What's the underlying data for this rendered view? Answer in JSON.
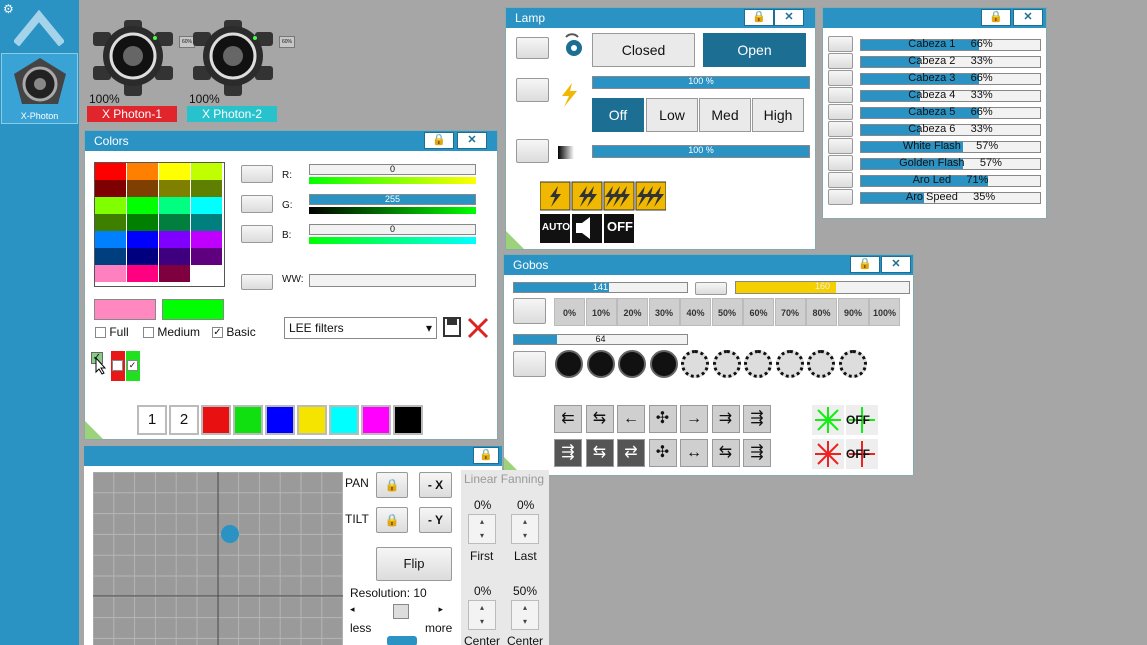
{
  "sidebar": {
    "fixture_label": "X-Photon",
    "icons": [
      "gear-icon",
      "chevron-up-icon"
    ]
  },
  "fixtures": [
    {
      "pct": "100%",
      "name": "X Photon-1",
      "color": "#e0252d",
      "badge": "60%"
    },
    {
      "pct": "100%",
      "name": "X Photon-2",
      "color": "#28c2cc",
      "badge": "60%"
    }
  ],
  "colors": {
    "title": "Colors",
    "palette": [
      "#ff0000",
      "#ff8000",
      "#ffff00",
      "#bfff00",
      "#7f0000",
      "#7f3f00",
      "#7f7f00",
      "#5f7f00",
      "#80ff00",
      "#00ff00",
      "#00ff80",
      "#00ffff",
      "#3f7f00",
      "#007f00",
      "#007f3f",
      "#007f7f",
      "#0080ff",
      "#0000ff",
      "#8000ff",
      "#bf00ff",
      "#003f7f",
      "#00007f",
      "#3f007f",
      "#5f007f",
      "#ff80c0",
      "#ff0080",
      "#7f003f",
      "#ffffff"
    ],
    "r_label": "R:",
    "r_value": "0",
    "g_label": "G:",
    "g_value": "255",
    "b_label": "B:",
    "b_value": "0",
    "ww_label": "WW:",
    "swatch1": "#ff88c0",
    "swatch2": "#00ff00",
    "filter_full": "Full",
    "filter_medium": "Medium",
    "filter_basic": "Basic",
    "basic_checked": "✓",
    "dropdown": "LEE filters",
    "presets": [
      {
        "label": "1",
        "color": "#ffffff"
      },
      {
        "label": "2",
        "color": "#ffffff"
      },
      {
        "label": "",
        "color": "#e81010"
      },
      {
        "label": "",
        "color": "#10e010"
      },
      {
        "label": "",
        "color": "#0000ff"
      },
      {
        "label": "",
        "color": "#f4e400"
      },
      {
        "label": "",
        "color": "#00ffff"
      },
      {
        "label": "",
        "color": "#ff00ff"
      },
      {
        "label": "",
        "color": "#000000"
      }
    ]
  },
  "lamp": {
    "title": "Lamp",
    "closed": "Closed",
    "open": "Open",
    "strobe_value": "100 %",
    "dimmer_value": "100 %",
    "off": "Off",
    "low": "Low",
    "med": "Med",
    "high": "High",
    "auto": "AUTO",
    "offlbl": "OFF"
  },
  "channels": {
    "rows": [
      {
        "name": "Cabeza 1",
        "value": "66%",
        "fill": 0.66
      },
      {
        "name": "Cabeza 2",
        "value": "33%",
        "fill": 0.33
      },
      {
        "name": "Cabeza 3",
        "value": "66%",
        "fill": 0.66
      },
      {
        "name": "Cabeza 4",
        "value": "33%",
        "fill": 0.33
      },
      {
        "name": "Cabeza 5",
        "value": "66%",
        "fill": 0.66
      },
      {
        "name": "Cabeza 6",
        "value": "33%",
        "fill": 0.33
      },
      {
        "name": "White Flash",
        "value": "57%",
        "fill": 0.57
      },
      {
        "name": "Golden Flash",
        "value": "57%",
        "fill": 0.57
      },
      {
        "name": "Aro Led",
        "value": "71%",
        "fill": 0.71
      },
      {
        "name": "Aro Speed",
        "value": "35%",
        "fill": 0.35
      }
    ]
  },
  "gobos": {
    "title": "Gobos",
    "bar1": "141",
    "bar1_fill": 0.55,
    "bar2": "160",
    "bar2_fill": 0.58,
    "bar3": "64",
    "bar3_fill": 0.25,
    "pcts": [
      "0%",
      "10%",
      "20%",
      "30%",
      "40%",
      "50%",
      "60%",
      "70%",
      "80%",
      "90%",
      "100%"
    ],
    "off": "OFF"
  },
  "pantilt": {
    "pan": "PAN",
    "tilt": "TILT",
    "x": "- X",
    "y": "- Y",
    "flip": "Flip",
    "resolution": "Resolution: 10",
    "less": "less",
    "more": "more",
    "fan_title": "Linear Fanning",
    "first_pct": "0%",
    "last_pct": "0%",
    "first": "First",
    "last": "Last",
    "c1_pct": "0%",
    "c2_pct": "50%",
    "center": "Center",
    "center2": "Center"
  }
}
